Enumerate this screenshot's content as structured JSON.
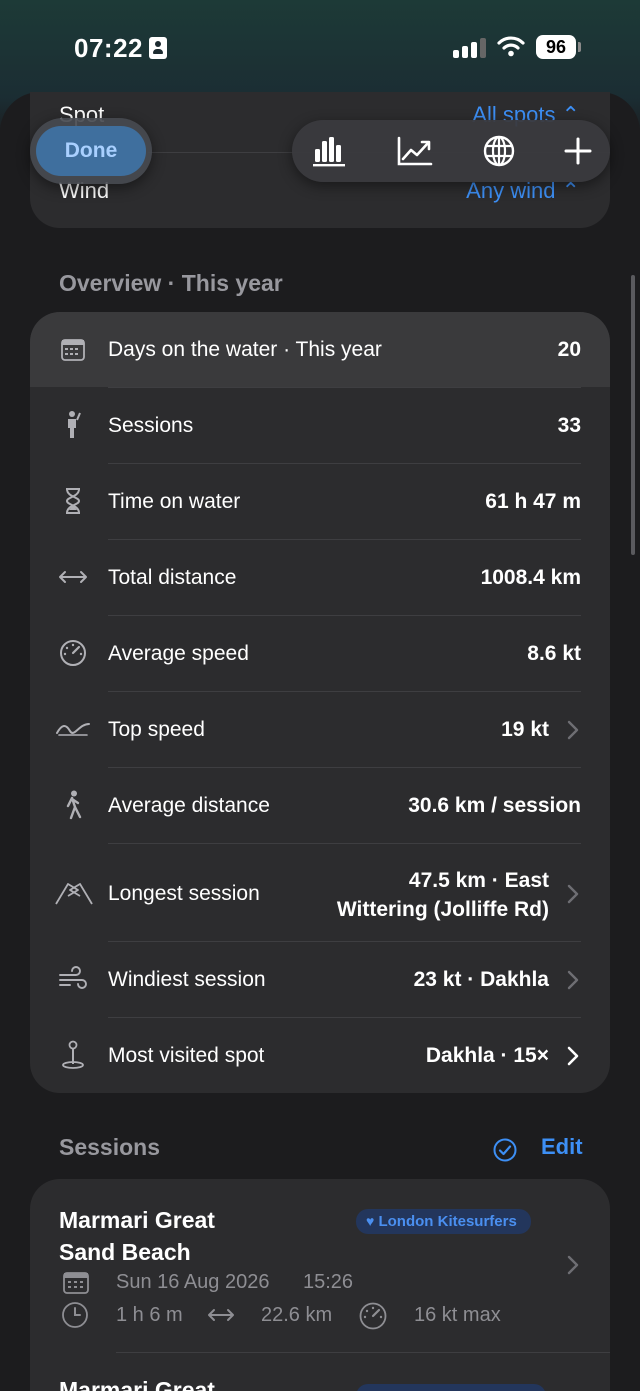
{
  "status_bar": {
    "time": "07:22",
    "battery": "96"
  },
  "filters": {
    "spot_label": "Spot",
    "spot_value": "All spots ⌃",
    "wind_label": "Wind",
    "wind_value": "Any wind ⌃"
  },
  "toolbar": {
    "done_label": "Done",
    "tools": [
      "bar-chart-icon",
      "trend-line-icon",
      "globe-icon",
      "plus-icon"
    ]
  },
  "overview": {
    "title": "Overview · This year",
    "rows": [
      {
        "icon": "calendar-icon",
        "label": "Days on the water · This year",
        "value": "20"
      },
      {
        "icon": "person-icon",
        "label": "Sessions",
        "value": "33"
      },
      {
        "icon": "hourglass-icon",
        "label": "Time on water",
        "value": "61 h 47 m"
      },
      {
        "icon": "arrows-horizontal-icon",
        "label": "Total distance",
        "value": "1008.4 km"
      },
      {
        "icon": "speedometer-icon",
        "label": "Average speed",
        "value": "8.6 kt"
      },
      {
        "icon": "wave-icon",
        "label": "Top speed",
        "value": "19 kt"
      },
      {
        "icon": "walking-icon",
        "label": "Average distance",
        "value": "30.6 km / session"
      },
      {
        "icon": "flags-icon",
        "label": "Longest session",
        "value_line1": "47.5 km · East",
        "value_line2": "Wittering (Jolliffe Rd)"
      },
      {
        "icon": "wind-icon",
        "label": "Windiest session",
        "value": "23 kt · Dakhla"
      },
      {
        "icon": "pin-icon",
        "label": "Most visited spot",
        "value": "Dakhla · 15×"
      }
    ]
  },
  "sessions": {
    "title": "Sessions",
    "edit_label": "Edit",
    "items": [
      {
        "title_line1": "Marmari Great",
        "title_line2": "Sand Beach",
        "club": "London Kitesurfers",
        "date": "Sun 16 Aug 2026",
        "time": "15:26",
        "duration": "1 h 6 m",
        "distance": "22.6 km",
        "max_speed": "16 kt max"
      },
      {
        "title_line1": "Marmari Great"
      }
    ]
  },
  "colors": {
    "accent": "#3d8ff5",
    "card": "#2c2c2e",
    "background": "#1c1c1e",
    "secondary_text": "#98989e"
  }
}
